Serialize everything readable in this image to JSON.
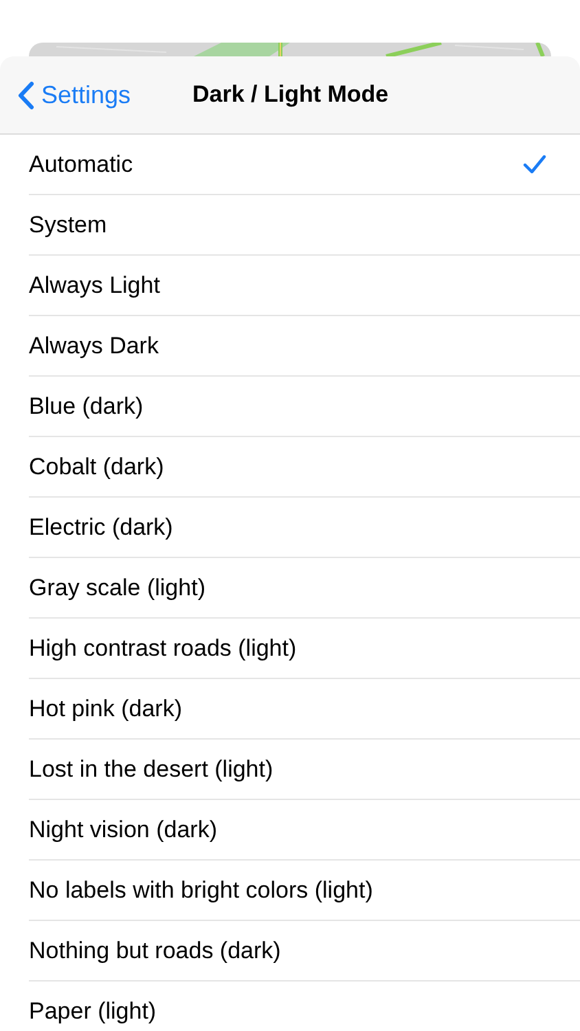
{
  "nav": {
    "back_label": "Settings",
    "title": "Dark / Light Mode"
  },
  "options": [
    {
      "label": "Automatic",
      "selected": true
    },
    {
      "label": "System",
      "selected": false
    },
    {
      "label": "Always Light",
      "selected": false
    },
    {
      "label": "Always Dark",
      "selected": false
    },
    {
      "label": "Blue (dark)",
      "selected": false
    },
    {
      "label": "Cobalt (dark)",
      "selected": false
    },
    {
      "label": "Electric (dark)",
      "selected": false
    },
    {
      "label": "Gray scale (light)",
      "selected": false
    },
    {
      "label": "High contrast roads (light)",
      "selected": false
    },
    {
      "label": "Hot pink (dark)",
      "selected": false
    },
    {
      "label": "Lost in the desert (light)",
      "selected": false
    },
    {
      "label": "Night vision (dark)",
      "selected": false
    },
    {
      "label": "No labels with bright colors (light)",
      "selected": false
    },
    {
      "label": "Nothing but roads (dark)",
      "selected": false
    },
    {
      "label": "Paper (light)",
      "selected": false
    }
  ]
}
